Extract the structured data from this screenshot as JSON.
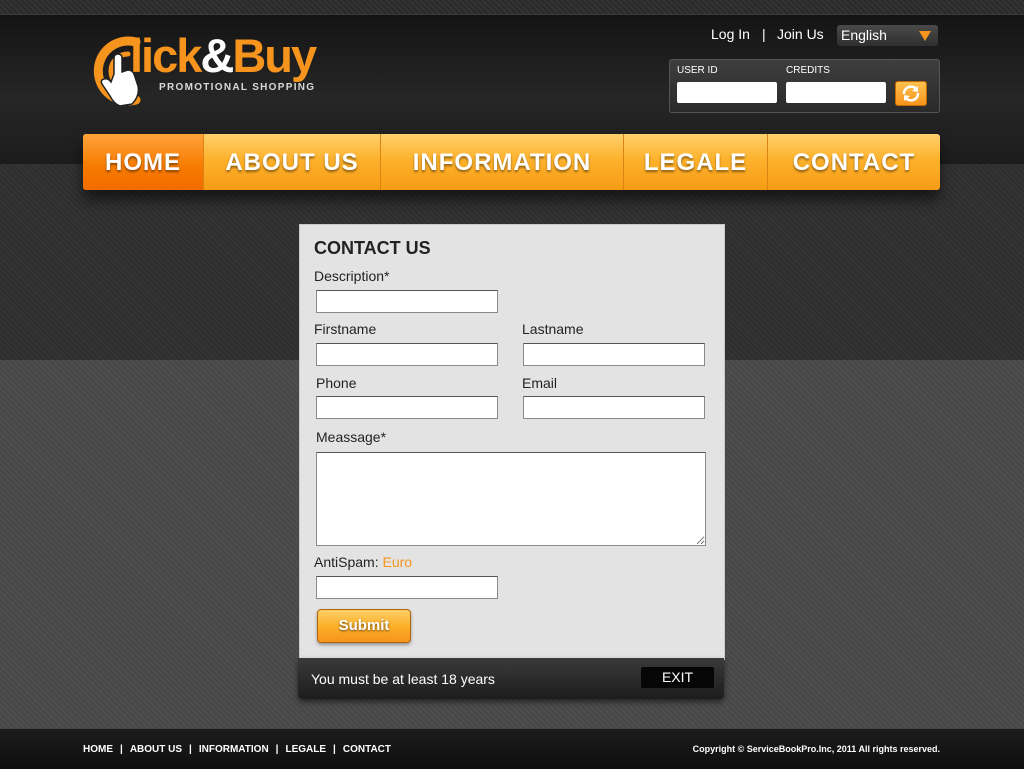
{
  "header": {
    "logo": {
      "word_a": "lick",
      "word_amp": "&",
      "word_b": "Buy",
      "tagline": "PROMOTIONAL SHOPPING"
    },
    "links": {
      "login": "Log In",
      "separator": "|",
      "join": "Join Us"
    },
    "language": {
      "selected": "English"
    },
    "login_box": {
      "user_id_label": "USER ID",
      "credits_label": "CREDITS",
      "refresh_icon": "refresh-icon"
    },
    "colors": {
      "accent": "#f7941d",
      "nav_gold": "#fdb22c",
      "nav_active": "#f77a00"
    }
  },
  "nav": {
    "items": [
      {
        "label": "HOME",
        "active": true
      },
      {
        "label": "ABOUT US",
        "active": false
      },
      {
        "label": "INFORMATION",
        "active": false
      },
      {
        "label": "LEGALE",
        "active": false
      },
      {
        "label": "CONTACT",
        "active": false
      }
    ]
  },
  "contact_form": {
    "title": "CONTACT US",
    "fields": {
      "description": {
        "label": "Description*",
        "value": ""
      },
      "firstname": {
        "label": "Firstname",
        "value": ""
      },
      "lastname": {
        "label": "Lastname",
        "value": ""
      },
      "phone": {
        "label": "Phone",
        "value": ""
      },
      "email": {
        "label": "Email",
        "value": ""
      },
      "message": {
        "label": "Meassage*",
        "value": ""
      },
      "antispam": {
        "label": "AntiSpam:",
        "hint": "Euro",
        "value": ""
      }
    },
    "submit_label": "Submit",
    "footer_note": "You must be at least 18 years",
    "exit_label": "EXIT"
  },
  "footer": {
    "links": [
      "HOME",
      "ABOUT US",
      "INFORMATION",
      "LEGALE",
      "CONTACT"
    ],
    "separator": "|",
    "copyright": "Copyright © ServiceBookPro.Inc, 2011 All rights reserved."
  }
}
